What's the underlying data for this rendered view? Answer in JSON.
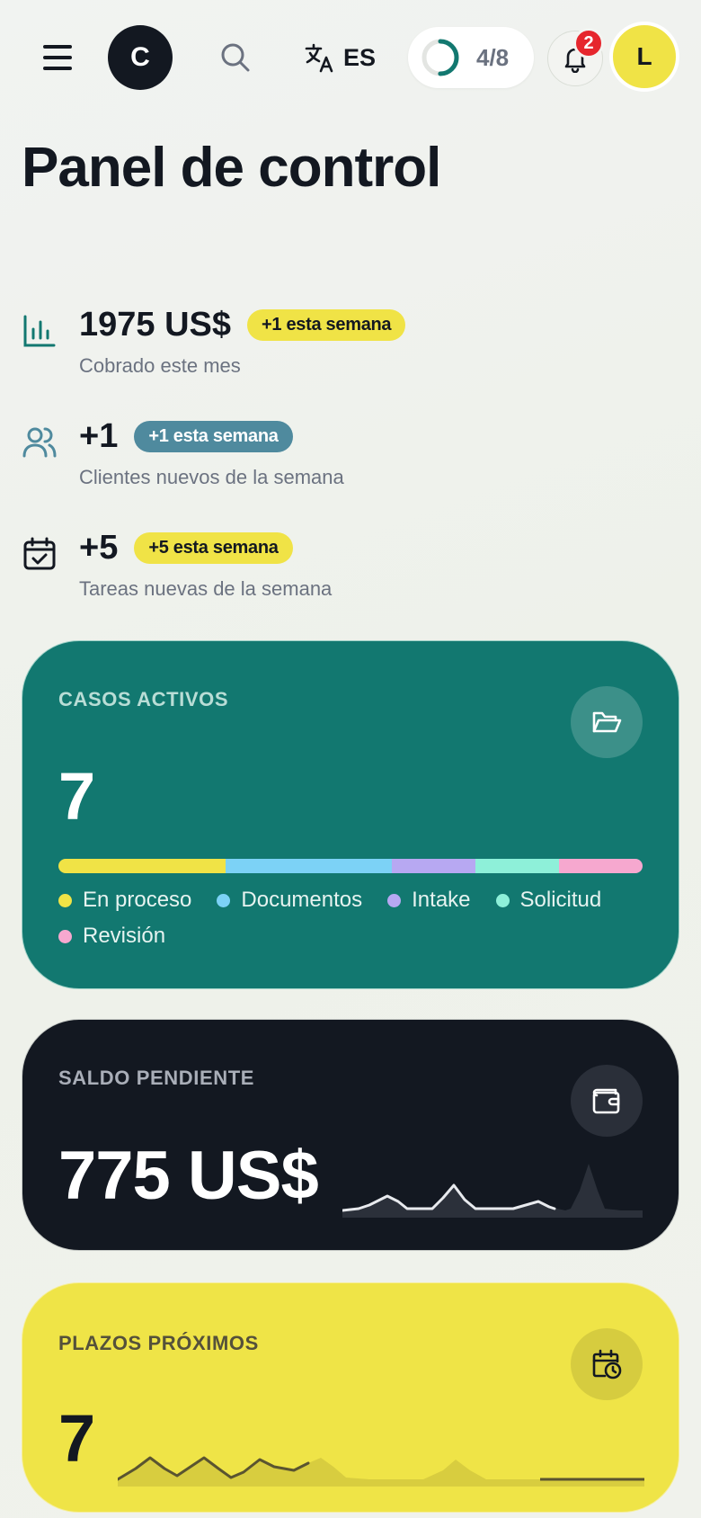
{
  "header": {
    "logo_letter": "C",
    "language": "ES",
    "progress_text": "4/8",
    "progress_value": 0.5,
    "notifications_count": "2",
    "avatar_letter": "L"
  },
  "page": {
    "title": "Panel de control"
  },
  "stats": [
    {
      "value": "1975 US$",
      "chip": "+1 esta semana",
      "label": "Cobrado este mes",
      "chip_bg": "#f0e346",
      "chip_fg": "#131821",
      "icon": "bar-chart-icon"
    },
    {
      "value": "+1",
      "chip": "+1 esta semana",
      "label": "Clientes nuevos de la semana",
      "chip_bg": "#4f8a9e",
      "chip_fg": "#ffffff",
      "icon": "users-icon"
    },
    {
      "value": "+5",
      "chip": "+5 esta semana",
      "label": "Tareas nuevas de la semana",
      "chip_bg": "#f0e346",
      "chip_fg": "#131821",
      "icon": "calendar-check-icon"
    }
  ],
  "active_cases": {
    "kicker": "CASOS ACTIVOS",
    "count": "7",
    "icon": "folder-open-icon",
    "segments": [
      {
        "name": "En proceso",
        "share": 2,
        "color": "#f0e346"
      },
      {
        "name": "Documentos",
        "share": 2,
        "color": "#7cd2f6"
      },
      {
        "name": "Intake",
        "share": 1,
        "color": "#b7a8f2"
      },
      {
        "name": "Solicitud",
        "share": 1,
        "color": "#8ef0d9"
      },
      {
        "name": "Revisión",
        "share": 1,
        "color": "#f6a8cf"
      }
    ]
  },
  "pending_balance": {
    "kicker": "SALDO PENDIENTE",
    "amount": "775 US$",
    "icon": "wallet-icon"
  },
  "deadlines": {
    "kicker": "PLAZOS PRÓXIMOS",
    "count": "7",
    "icon": "calendar-clock-icon"
  },
  "colors": {
    "teal": "#127870",
    "dark": "#131821",
    "yellow": "#efe447",
    "accent_red": "#e6262d"
  }
}
